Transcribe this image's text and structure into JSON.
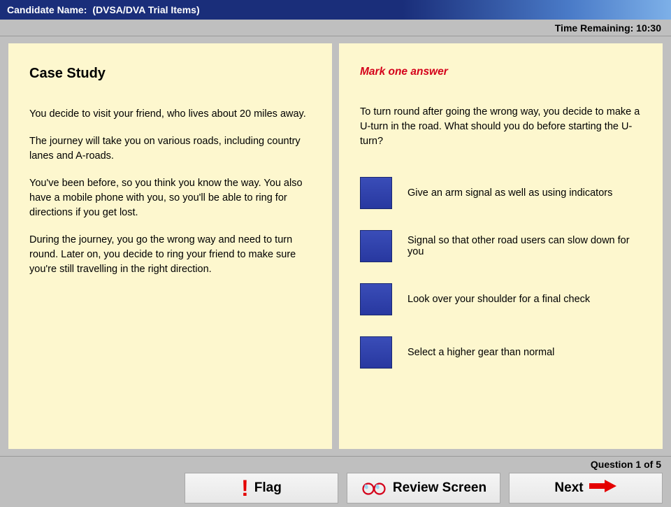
{
  "header": {
    "candidate_label": "Candidate Name:",
    "candidate_name": "(DVSA/DVA Trial Items)"
  },
  "timer": {
    "label": "Time Remaining: 10:30"
  },
  "case_study": {
    "heading": "Case Study",
    "paragraphs": [
      "You decide to visit your friend, who lives about 20 miles away.",
      "The journey will take you on various roads, including country lanes and A-roads.",
      "You've been before, so you think you know the way. You also have a mobile phone with you, so you'll be able to ring for directions if you get lost.",
      "During the journey, you go the wrong way and need to turn round. Later on, you decide to ring your friend to make sure you're still travelling in the right direction."
    ]
  },
  "question": {
    "instruction": "Mark one answer",
    "text": "To turn round after going the wrong way, you decide to make a U-turn in the road. What should you do before starting the U-turn?",
    "answers": [
      "Give an arm signal as well as using indicators",
      "Signal so that other road users can slow down for you",
      "Look over your shoulder for a final check",
      "Select a higher gear than normal"
    ]
  },
  "footer": {
    "progress": "Question 1 of 5"
  },
  "buttons": {
    "flag": "Flag",
    "review": "Review Screen",
    "next": "Next"
  }
}
